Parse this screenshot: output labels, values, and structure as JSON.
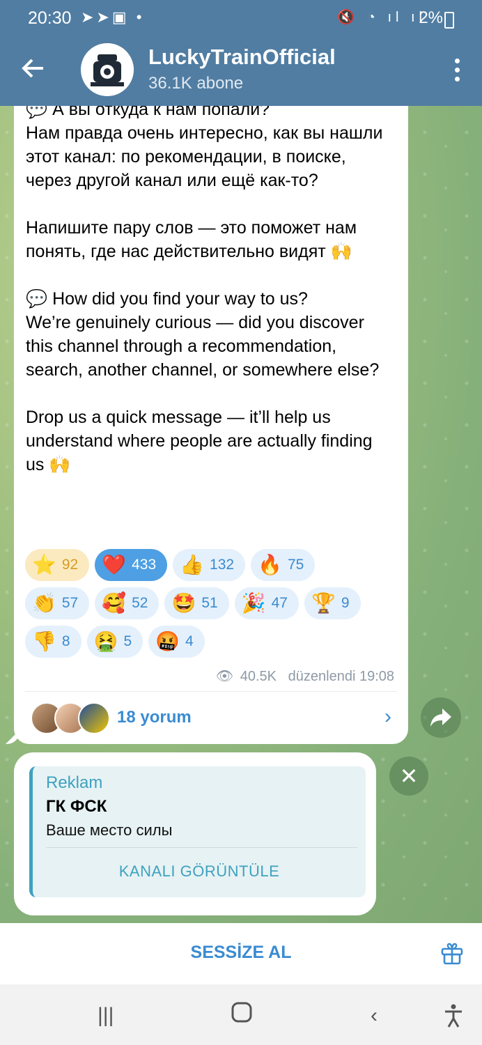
{
  "status_bar": {
    "time": "20:30",
    "left_icons": "telegram-icon telegram-icon gallery-icon",
    "dot": "•",
    "battery": "2%"
  },
  "header": {
    "back_icon": "arrow-left-icon",
    "channel_name": "LuckyTrainOfficial",
    "subscribers": "36.1K abone",
    "menu_icon": "more-vertical-icon"
  },
  "message": {
    "text": "💬 А вы откуда к нам попали?\nНам правда очень интересно, как вы нашли этот канал: по рекомендации, в поиске, через другой канал или ещё как-то?\n\nНапишите пару слов — это поможет нам понять, где нас действительно видят 🙌\n\n💬 How did you find your way to us?\nWe’re genuinely curious — did you discover this channel through a recommendation, search, another channel, or somewhere else?\n\nDrop us a quick message — it’ll help us understand where people are actually finding us 🙌",
    "reactions": [
      [
        {
          "emoji": "⭐",
          "count": "92",
          "style": "star"
        },
        {
          "emoji": "❤️",
          "count": "433",
          "style": "heart"
        },
        {
          "emoji": "👍",
          "count": "132"
        },
        {
          "emoji": "🔥",
          "count": "75"
        }
      ],
      [
        {
          "emoji": "👏",
          "count": "57"
        },
        {
          "emoji": "🥰",
          "count": "52"
        },
        {
          "emoji": "🤩",
          "count": "51"
        },
        {
          "emoji": "🎉",
          "count": "47"
        },
        {
          "emoji": "🏆",
          "count": "9"
        }
      ],
      [
        {
          "emoji": "👎",
          "count": "8"
        },
        {
          "emoji": "🤮",
          "count": "5"
        },
        {
          "emoji": "🤬",
          "count": "4"
        }
      ]
    ],
    "views": "40.5K",
    "edited": "düzenlendi 19:08",
    "comments_label": "18 yorum"
  },
  "sponsored": {
    "tag": "Reklam",
    "name": "ГК ФСК",
    "description": "Ваше место силы",
    "cta": "KANALI GÖRÜNTÜLE"
  },
  "bottom": {
    "mute": "SESSİZE AL"
  },
  "colors": {
    "header": "#517da2",
    "accent": "#3a8bd1",
    "ad_accent": "#3ea2bf"
  }
}
